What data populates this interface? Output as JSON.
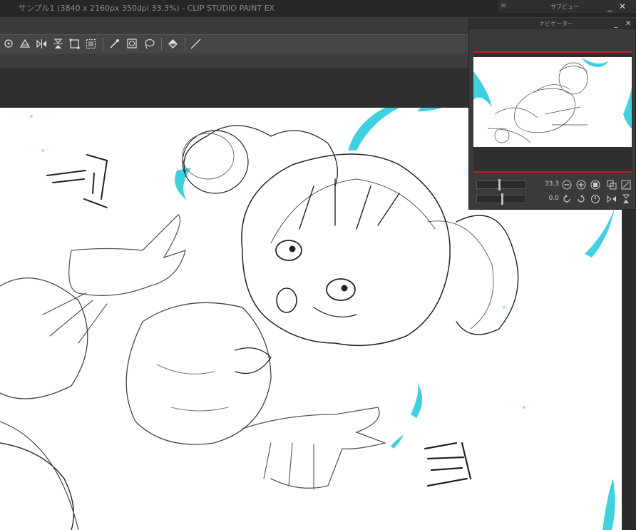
{
  "window": {
    "title": "サンプル1 (3840 x 2160px 350dpi 33.3%)  - CLIP STUDIO PAINT EX"
  },
  "subview_panel": {
    "title": "サブビュー",
    "menu_icon": "hamburger-icon",
    "minimize_icon": "minimize-icon",
    "close_icon": "close-icon"
  },
  "navigator_panel": {
    "title": "ナビゲーター",
    "zoom_value": "33.3",
    "rotation_value": "0.0"
  },
  "toolbar": {
    "tools": [
      {
        "name": "transform-tool-icon"
      },
      {
        "name": "fill-clear-icon"
      },
      {
        "name": "flip-horizontal-icon"
      },
      {
        "name": "flip-vertical-icon"
      },
      {
        "name": "free-transform-icon"
      },
      {
        "name": "selection-icon"
      },
      {
        "name": "eyedropper-icon"
      },
      {
        "name": "layer-reference-icon"
      },
      {
        "name": "lasso-fill-icon"
      },
      {
        "name": "fill-bucket-icon"
      },
      {
        "name": "line-icon"
      }
    ]
  },
  "colors": {
    "accent_cyan": "#3fd1df",
    "line": "#222222",
    "red_guide": "#c0201f"
  }
}
